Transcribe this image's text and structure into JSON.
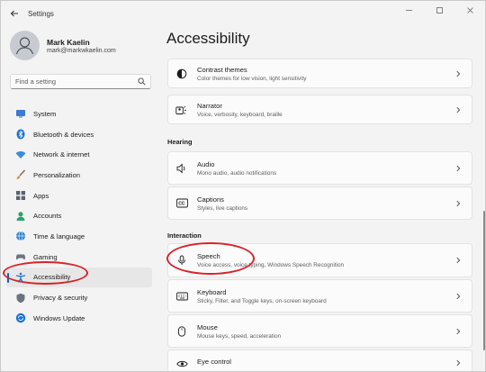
{
  "window": {
    "title": "Settings",
    "controls": [
      "minimize-icon",
      "maximize-icon",
      "close-icon"
    ]
  },
  "user": {
    "name": "Mark Kaelin",
    "email": "mark@markwkaelin.com"
  },
  "search": {
    "placeholder": "Find a setting",
    "icon": "search-icon"
  },
  "sidebar": {
    "items": [
      {
        "label": "System",
        "icon": "system-icon",
        "color": "#3a7bd5"
      },
      {
        "label": "Bluetooth & devices",
        "icon": "bluetooth-icon",
        "color": "#1e73d1"
      },
      {
        "label": "Network & internet",
        "icon": "wifi-icon",
        "color": "#3b8de0"
      },
      {
        "label": "Personalization",
        "icon": "brush-icon",
        "color": "#e08a3b"
      },
      {
        "label": "Apps",
        "icon": "apps-icon",
        "color": "#5a6270"
      },
      {
        "label": "Accounts",
        "icon": "accounts-icon",
        "color": "#2aa36b"
      },
      {
        "label": "Time & language",
        "icon": "globe-icon",
        "color": "#2b7fd0"
      },
      {
        "label": "Gaming",
        "icon": "gaming-icon",
        "color": "#6b7280"
      },
      {
        "label": "Accessibility",
        "icon": "accessibility-icon",
        "color": "#1a73d9",
        "active": true
      },
      {
        "label": "Privacy & security",
        "icon": "shield-icon",
        "color": "#6b7280"
      },
      {
        "label": "Windows Update",
        "icon": "update-icon",
        "color": "#1a73d9"
      }
    ]
  },
  "main": {
    "title": "Accessibility",
    "vision_cards": [
      {
        "title": "Contrast themes",
        "desc": "Color themes for low vision, light sensitivity",
        "icon": "contrast-icon"
      },
      {
        "title": "Narrator",
        "desc": "Voice, verbosity, keyboard, braille",
        "icon": "narrator-icon"
      }
    ],
    "hearing_label": "Hearing",
    "hearing_cards": [
      {
        "title": "Audio",
        "desc": "Mono audio, audio notifications",
        "icon": "speaker-icon"
      },
      {
        "title": "Captions",
        "desc": "Styles, live captions",
        "icon": "captions-icon"
      }
    ],
    "interaction_label": "Interaction",
    "interaction_cards": [
      {
        "title": "Speech",
        "desc": "Voice access, voice typing, Windows Speech Recognition",
        "icon": "microphone-icon"
      },
      {
        "title": "Keyboard",
        "desc": "Sticky, Filter, and Toggle keys, on-screen keyboard",
        "icon": "keyboard-icon"
      },
      {
        "title": "Mouse",
        "desc": "Mouse keys, speed, acceleration",
        "icon": "mouse-icon"
      },
      {
        "title": "Eye control",
        "desc": "",
        "icon": "eye-icon"
      }
    ]
  },
  "colors": {
    "accent": "#0067c0",
    "annotation": "#d8232a",
    "background": "#f3f3f3",
    "card": "#fbfbfb"
  }
}
